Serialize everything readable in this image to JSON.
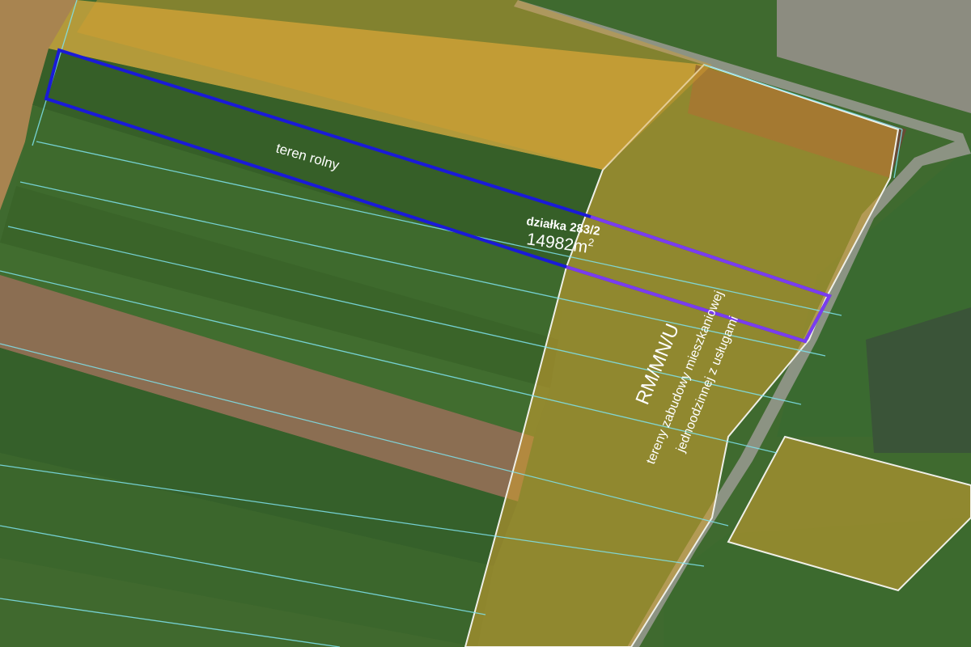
{
  "map": {
    "land_label": "teren rolny",
    "plot": {
      "name": "działka 283/2",
      "area_value": "14982m",
      "area_unit_sup": "2"
    },
    "zone": {
      "code": "RM/MN/U",
      "description_line1": "tereny zabudowy mieszkaniowej",
      "description_line2": "jednoodzinnej z usługami"
    }
  },
  "colors": {
    "field_green": "#3f6a2f",
    "zone_overlay": "#d4a030",
    "plot_outline": "#1a1ad8",
    "plot_outline_inside_zone": "#7a3cf0",
    "parcel_lines": "#7fe3ee",
    "zone_border": "#f0f0e8",
    "label_text": "#ffffff"
  }
}
